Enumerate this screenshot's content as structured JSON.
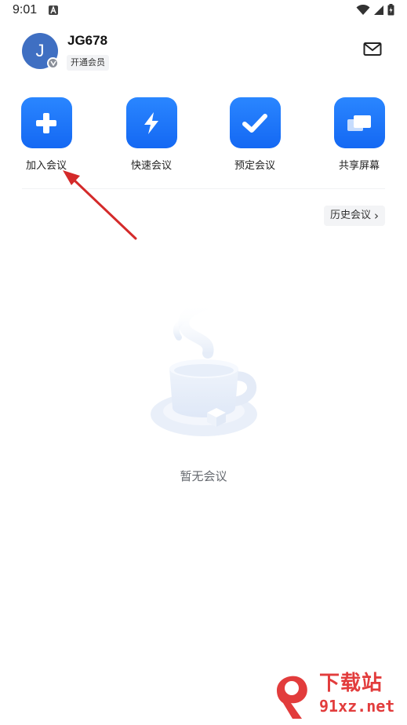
{
  "status_bar": {
    "time": "9:01",
    "notification_icon": "a-letter-icon",
    "icons": [
      "wifi-icon",
      "signal-icon",
      "battery-charging-icon"
    ]
  },
  "header": {
    "avatar_initial": "J",
    "avatar_color": "#3f6fc2",
    "username": "JG678",
    "vip_label": "开通会员",
    "mail_icon": "mail-icon"
  },
  "actions": [
    {
      "label": "加入会议",
      "icon": "plus-icon"
    },
    {
      "label": "快速会议",
      "icon": "lightning-icon"
    },
    {
      "label": "预定会议",
      "icon": "checkmark-icon"
    },
    {
      "label": "共享屏幕",
      "icon": "screens-icon"
    }
  ],
  "accent_color": "#1b74f7",
  "history": {
    "label": "历史会议",
    "chevron": "›"
  },
  "empty_state": {
    "text": "暂无会议",
    "illustration": "coffee-cup-illustration"
  },
  "watermark": {
    "brand_top": "下载站",
    "brand_bottom": "91xz.net",
    "brand_color": "#e23c3c"
  }
}
